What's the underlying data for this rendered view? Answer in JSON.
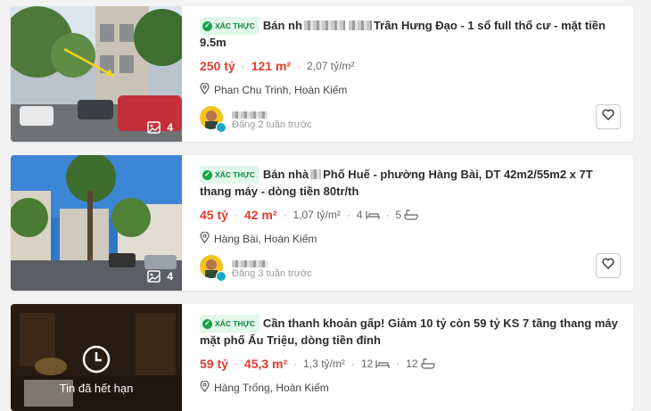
{
  "listings": [
    {
      "verified_badge": "XÁC THỰC",
      "title_pre": "Bán nh",
      "title_post": "Trần Hưng Đạo - 1 sổ full thổ cư - mặt tiền 9.5m",
      "price": "250 tỷ",
      "area": "121 m²",
      "price_per_m2": "2,07 tỷ/m²",
      "location": "Phan Chu Trinh, Hoàn Kiếm",
      "photo_count": "4",
      "posted": "Đăng 2 tuần trước",
      "icons": [
        "image-stack-icon",
        "location-pin-icon",
        "heart-icon"
      ]
    },
    {
      "verified_badge": "XÁC THỰC",
      "title_pre": "Bán nhà",
      "title_post": "Phố Huế - phường Hàng Bài, DT 42m2/55m2 x 7T thang máy - dòng tiền 80tr/th",
      "price": "45 tỷ",
      "area": "42 m²",
      "price_per_m2": "1,07 tỷ/m²",
      "bedrooms": "4",
      "bathrooms": "5",
      "location": "Hàng Bài, Hoàn Kiếm",
      "photo_count": "4",
      "posted": "Đăng 3 tuần trước",
      "icons": [
        "image-stack-icon",
        "bed-icon",
        "bath-icon",
        "location-pin-icon",
        "heart-icon"
      ]
    },
    {
      "verified_badge": "XÁC THỰC",
      "title": "Cần thanh khoản gấp! Giảm 10 tỷ còn 59 tỷ KS 7 tầng thang máy mặt phố Ấu Triệu, dòng tiền đỉnh",
      "price": "59 tỷ",
      "area": "45,3 m²",
      "price_per_m2": "1,3 tỷ/m²",
      "bedrooms": "12",
      "bathrooms": "12",
      "location": "Hàng Trống, Hoàn Kiếm",
      "expired_label": "Tin đã hết hạn",
      "icons": [
        "clock-icon",
        "bed-icon",
        "bath-icon",
        "location-pin-icon"
      ]
    }
  ],
  "colors": {
    "accent_red": "#e03c31",
    "verified_green": "#18a24a",
    "badge_bg": "#e3f6ea"
  }
}
